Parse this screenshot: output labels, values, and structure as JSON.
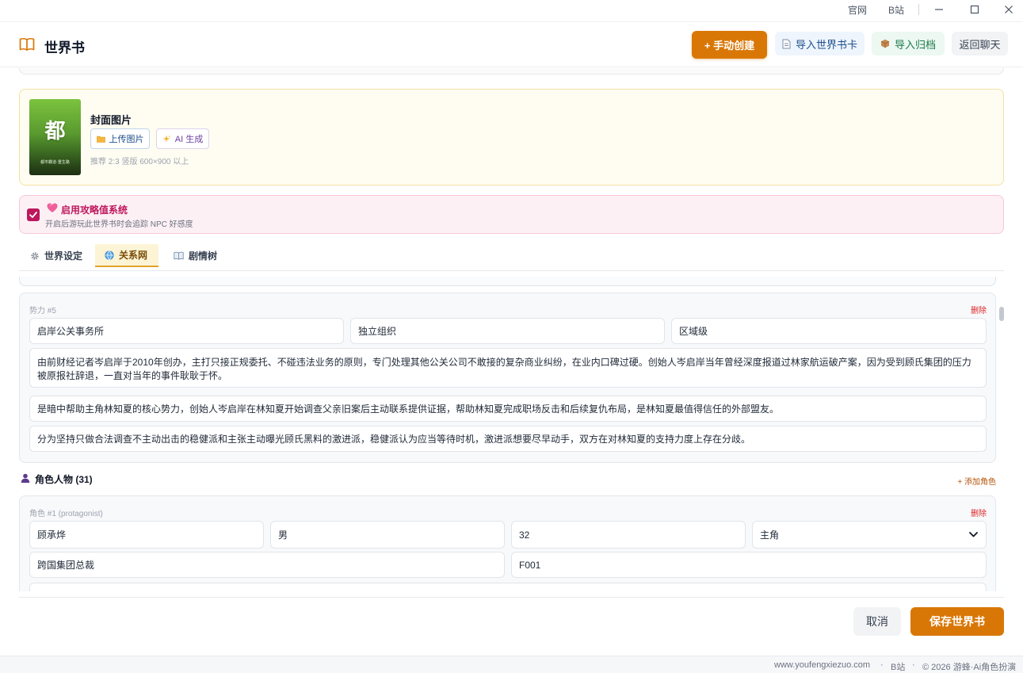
{
  "titlebar": {
    "link_official": "官网",
    "link_bilibili": "B站"
  },
  "header": {
    "title": "世界书",
    "manual_create": "+ 手动创建",
    "import_card": "导入世界书卡",
    "import_archive": "导入归档",
    "back_to_chat": "返回聊天"
  },
  "cover": {
    "thumb_char": "都",
    "thumb_caption": "都市霸道·重生路",
    "label": "封面图片",
    "upload": "上传图片",
    "ai_generate": "AI 生成",
    "hint": "推荐 2:3 竖版 600×900 以上"
  },
  "affinity": {
    "enabled": true,
    "title": "启用攻略值系统",
    "description": "开启后游玩此世界书时会追踪 NPC 好感度"
  },
  "tabs": [
    {
      "label": "世界设定",
      "icon": "gear-icon",
      "active": false
    },
    {
      "label": "关系网",
      "icon": "globe-icon",
      "active": true
    },
    {
      "label": "剧情树",
      "icon": "open-book-icon",
      "active": false
    }
  ],
  "faction": {
    "label": "势力 #5",
    "delete": "删除",
    "name": "启岸公关事务所",
    "type": "独立组织",
    "scope": "区域级",
    "background": "由前财经记者岑启岸于2010年创办，主打只接正规委托、不碰违法业务的原则，专门处理其他公关公司不敢接的复杂商业纠纷，在业内口碑过硬。创始人岑启岸当年曾经深度报道过林家航运破产案，因为受到顾氏集团的压力被原报社辞退，一直对当年的事件耿耿于怀。",
    "role": "是暗中帮助主角林知夏的核心势力，创始人岑启岸在林知夏开始调查父亲旧案后主动联系提供证据，帮助林知夏完成职场反击和后续复仇布局，是林知夏最值得信任的外部盟友。",
    "conflict": "分为坚持只做合法调查不主动出击的稳健派和主张主动曝光顾氏黑料的激进派，稳健派认为应当等待时机，激进派想要尽早动手，双方在对林知夏的支持力度上存在分歧。"
  },
  "characters": {
    "section_title": "角色人物 (31)",
    "add": "+ 添加角色",
    "first": {
      "label": "角色 #1 (protagonist)",
      "delete": "删除",
      "name": "顾承烨",
      "gender": "男",
      "age": "32",
      "role_select": "主角",
      "identity": "跨国集团总裁",
      "code": "F001"
    }
  },
  "footer": {
    "cancel": "取消",
    "save": "保存世界书"
  },
  "statusbar": {
    "website": "www.youfengxiezuo.com",
    "bilibili": "B站",
    "copyright": "© 2026 游蜂·Ai角色扮演"
  },
  "colors": {
    "accent": "#d97706",
    "affinity": "#be185d",
    "danger": "#dc2626"
  }
}
